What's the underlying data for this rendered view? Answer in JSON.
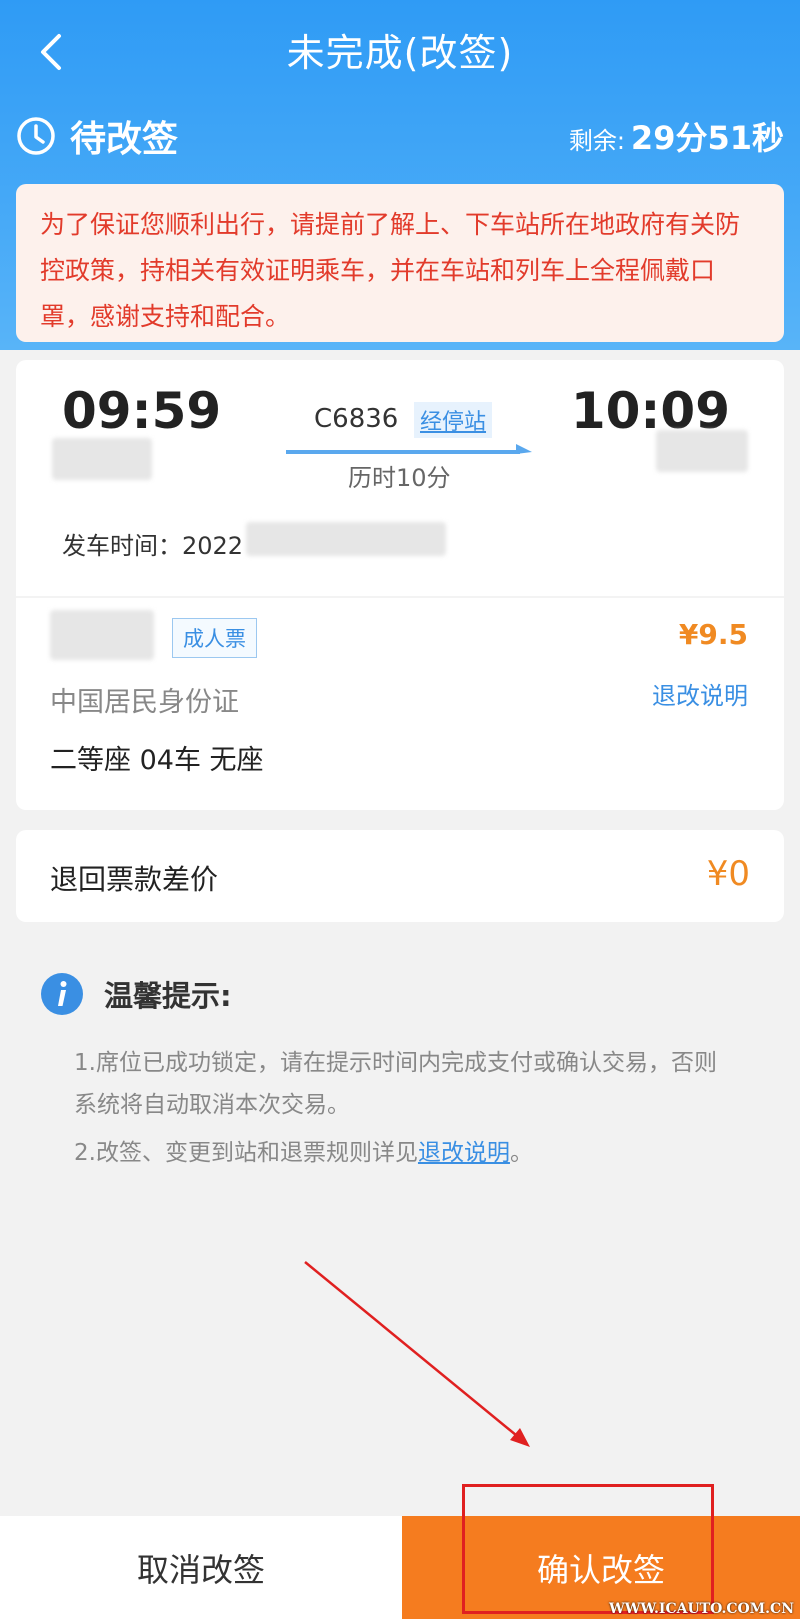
{
  "header": {
    "title": "未完成(改签)",
    "status": "待改签",
    "countdown_label": "剩余:",
    "countdown_value": "29分51秒"
  },
  "notice": {
    "text": "为了保证您顺利出行，请提前了解上、下车站所在地政府有关防控政策，持相关有效证明乘车，并在车站和列车上全程佩戴口罩，感谢支持和配合。"
  },
  "trip": {
    "departure_time": "09:59",
    "arrival_time": "10:09",
    "train_number": "C6836",
    "stops_link": "经停站",
    "duration": "历时10分",
    "departure_label": "发车时间：2022"
  },
  "passenger": {
    "ticket_type": "成人票",
    "price": "¥9.5",
    "id_type": "中国居民身份证",
    "rules_link": "退改说明",
    "seat_info": "二等座  04车  无座"
  },
  "refund": {
    "label": "退回票款差价",
    "value": "¥0"
  },
  "tips": {
    "title": "温馨提示:",
    "tip1": "1.席位已成功锁定，请在提示时间内完成支付或确认交易，否则系统将自动取消本次交易。",
    "tip2_prefix": "2.改签、变更到站和退票规则详见",
    "tip2_link": "退改说明",
    "tip2_suffix": "。"
  },
  "footer": {
    "cancel_label": "取消改签",
    "confirm_label": "确认改签"
  },
  "watermark": "WWW.ICAUTO.COM.CN",
  "colors": {
    "header_blue": "#2f9bf5",
    "accent_orange": "#f57c1f",
    "price_orange": "#f08a22",
    "link_blue": "#3a8fe3",
    "notice_red": "#e23b2b",
    "annotation_red": "#e02020"
  }
}
